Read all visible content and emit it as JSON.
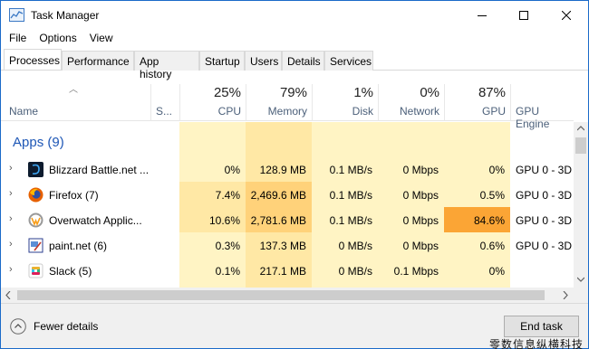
{
  "window": {
    "title": "Task Manager",
    "accent": "#1b6ac9"
  },
  "menu": [
    "File",
    "Options",
    "View"
  ],
  "tabs": [
    "Processes",
    "Performance",
    "App history",
    "Startup",
    "Users",
    "Details",
    "Services"
  ],
  "active_tab": "Processes",
  "columns": {
    "name": "Name",
    "status": "S...",
    "cpu": {
      "label": "CPU",
      "pct": "25%"
    },
    "memory": {
      "label": "Memory",
      "pct": "79%"
    },
    "disk": {
      "label": "Disk",
      "pct": "1%"
    },
    "network": {
      "label": "Network",
      "pct": "0%"
    },
    "gpu": {
      "label": "GPU",
      "pct": "87%"
    },
    "gpu_engine": {
      "label": "GPU Engine"
    }
  },
  "group": {
    "label": "Apps (9)"
  },
  "rows": [
    {
      "name": "Blizzard Battle.net ...",
      "icon": "battlenet-icon",
      "cpu": "0%",
      "memory": "128.9 MB",
      "disk": "0.1 MB/s",
      "network": "0 Mbps",
      "gpu": "0%",
      "gpu_engine": "GPU 0 - 3D"
    },
    {
      "name": "Firefox (7)",
      "icon": "firefox-icon",
      "cpu": "7.4%",
      "memory": "2,469.6 MB",
      "disk": "0.1 MB/s",
      "network": "0 Mbps",
      "gpu": "0.5%",
      "gpu_engine": "GPU 0 - 3D"
    },
    {
      "name": "Overwatch Applic...",
      "icon": "overwatch-icon",
      "cpu": "10.6%",
      "memory": "2,781.6 MB",
      "disk": "0.1 MB/s",
      "network": "0 Mbps",
      "gpu": "84.6%",
      "gpu_engine": "GPU 0 - 3D"
    },
    {
      "name": "paint.net (6)",
      "icon": "paintnet-icon",
      "cpu": "0.3%",
      "memory": "137.3 MB",
      "disk": "0 MB/s",
      "network": "0 Mbps",
      "gpu": "0.6%",
      "gpu_engine": "GPU 0 - 3D"
    },
    {
      "name": "Slack (5)",
      "icon": "slack-icon",
      "cpu": "0.1%",
      "memory": "217.1 MB",
      "disk": "0 MB/s",
      "network": "0.1 Mbps",
      "gpu": "0%",
      "gpu_engine": ""
    }
  ],
  "heat_colors": {
    "light": "#fff4c4",
    "medium": "#ffe8a5",
    "strong": "#ffd27a",
    "hot": "#fba535"
  },
  "footer": {
    "fewer_details": "Fewer details",
    "end_task": "End task"
  },
  "watermark": "零数信息纵横科技"
}
